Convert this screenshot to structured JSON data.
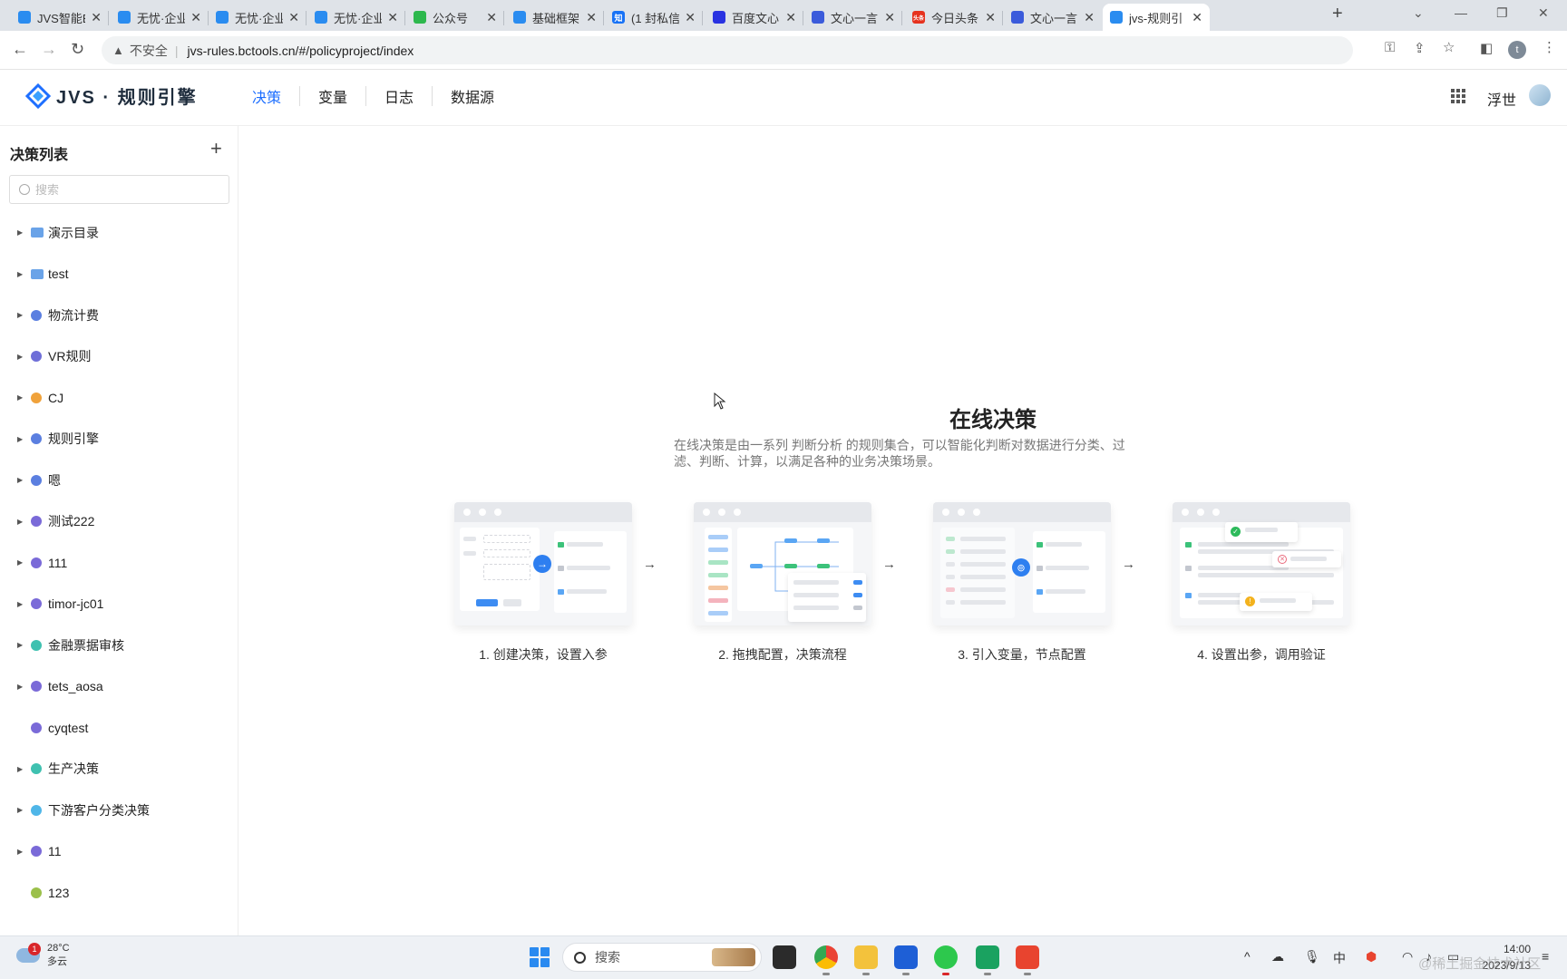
{
  "browser": {
    "tabs": [
      {
        "title": "JVS智能B",
        "fav_color": "#2a8cf0",
        "fav_char": ""
      },
      {
        "title": "无忧·企业",
        "fav_color": "#2a8cf0",
        "fav_char": ""
      },
      {
        "title": "无忧·企业",
        "fav_color": "#2a8cf0",
        "fav_char": ""
      },
      {
        "title": "无忧·企业",
        "fav_color": "#2a8cf0",
        "fav_char": ""
      },
      {
        "title": "公众号",
        "fav_color": "#2db84d",
        "fav_char": ""
      },
      {
        "title": "基础框架",
        "fav_color": "#2a8cf0",
        "fav_char": ""
      },
      {
        "title": "(1 封私信",
        "fav_color": "#1772f6",
        "fav_char": "知"
      },
      {
        "title": "百度文心",
        "fav_color": "#2932e1",
        "fav_char": ""
      },
      {
        "title": "文心一言",
        "fav_color": "#3b5bdb",
        "fav_char": ""
      },
      {
        "title": "今日头条",
        "fav_color": "#e6321e",
        "fav_char": "头条"
      },
      {
        "title": "文心一言",
        "fav_color": "#3b5bdb",
        "fav_char": ""
      },
      {
        "title": "jvs-规则引",
        "fav_color": "#2a8cf0",
        "fav_char": ""
      }
    ],
    "close_glyph": "✕",
    "new_tab_glyph": "+",
    "security_label": "不安全",
    "url": "jvs-rules.bctools.cn/#/policyproject/index",
    "profile_initial": "t"
  },
  "app": {
    "logo_text": "JVS · 规则引擎",
    "nav": [
      {
        "label": "决策",
        "active": true
      },
      {
        "label": "变量",
        "active": false
      },
      {
        "label": "日志",
        "active": false
      },
      {
        "label": "数据源",
        "active": false
      }
    ],
    "username": "浮世"
  },
  "sidebar": {
    "title": "决策列表",
    "add_glyph": "+",
    "search_placeholder": "搜索",
    "items": [
      {
        "label": "演示目录",
        "type": "folder",
        "color": "#6aa3e8",
        "expandable": true
      },
      {
        "label": "test",
        "type": "folder",
        "color": "#6aa3e8",
        "expandable": true
      },
      {
        "label": "物流计费",
        "type": "app",
        "color": "#5b7fe0",
        "expandable": true
      },
      {
        "label": "VR规则",
        "type": "app",
        "color": "#6f6fd8",
        "expandable": true
      },
      {
        "label": "CJ",
        "type": "app",
        "color": "#f0a23b",
        "expandable": true
      },
      {
        "label": "规则引擎",
        "type": "app",
        "color": "#5b7fe0",
        "expandable": true
      },
      {
        "label": "嗯",
        "type": "app",
        "color": "#5b7fe0",
        "expandable": true
      },
      {
        "label": "测试222",
        "type": "app",
        "color": "#7a6ad8",
        "expandable": true
      },
      {
        "label": "111",
        "type": "app",
        "color": "#7a6ad8",
        "expandable": true
      },
      {
        "label": "timor-jc01",
        "type": "app",
        "color": "#7a6ad8",
        "expandable": true
      },
      {
        "label": "金融票据审核",
        "type": "app",
        "color": "#3fc1b0",
        "expandable": true
      },
      {
        "label": "tets_aosa",
        "type": "app",
        "color": "#7a6ad8",
        "expandable": true
      },
      {
        "label": "cyqtest",
        "type": "app",
        "color": "#7a6ad8",
        "expandable": false
      },
      {
        "label": "生产决策",
        "type": "app",
        "color": "#3fc1b0",
        "expandable": true
      },
      {
        "label": "下游客户分类决策",
        "type": "app",
        "color": "#4fb6e8",
        "expandable": true
      },
      {
        "label": "11",
        "type": "app",
        "color": "#7a6ad8",
        "expandable": true
      },
      {
        "label": "123",
        "type": "app",
        "color": "#9bc04a",
        "expandable": false
      }
    ]
  },
  "main": {
    "title": "在线决策",
    "description": "在线决策是由一系列 判断分析 的规则集合，可以智能化判断对数据进行分类、过滤、判断、计算，以满足各种的业务决策场景。",
    "steps": [
      {
        "label": "1. 创建决策，设置入参"
      },
      {
        "label": "2. 拖拽配置，决策流程"
      },
      {
        "label": "3. 引入变量，节点配置"
      },
      {
        "label": "4. 设置出参，调用验证"
      }
    ],
    "arrow_glyph": "→"
  },
  "taskbar": {
    "weather_temp": "28°C",
    "weather_desc": "多云",
    "weather_badge": "1",
    "search_label": "搜索",
    "ime_label": "中",
    "time": "14:00",
    "date": "2023/9/13"
  },
  "watermark": "@稀土掘金技术社区"
}
